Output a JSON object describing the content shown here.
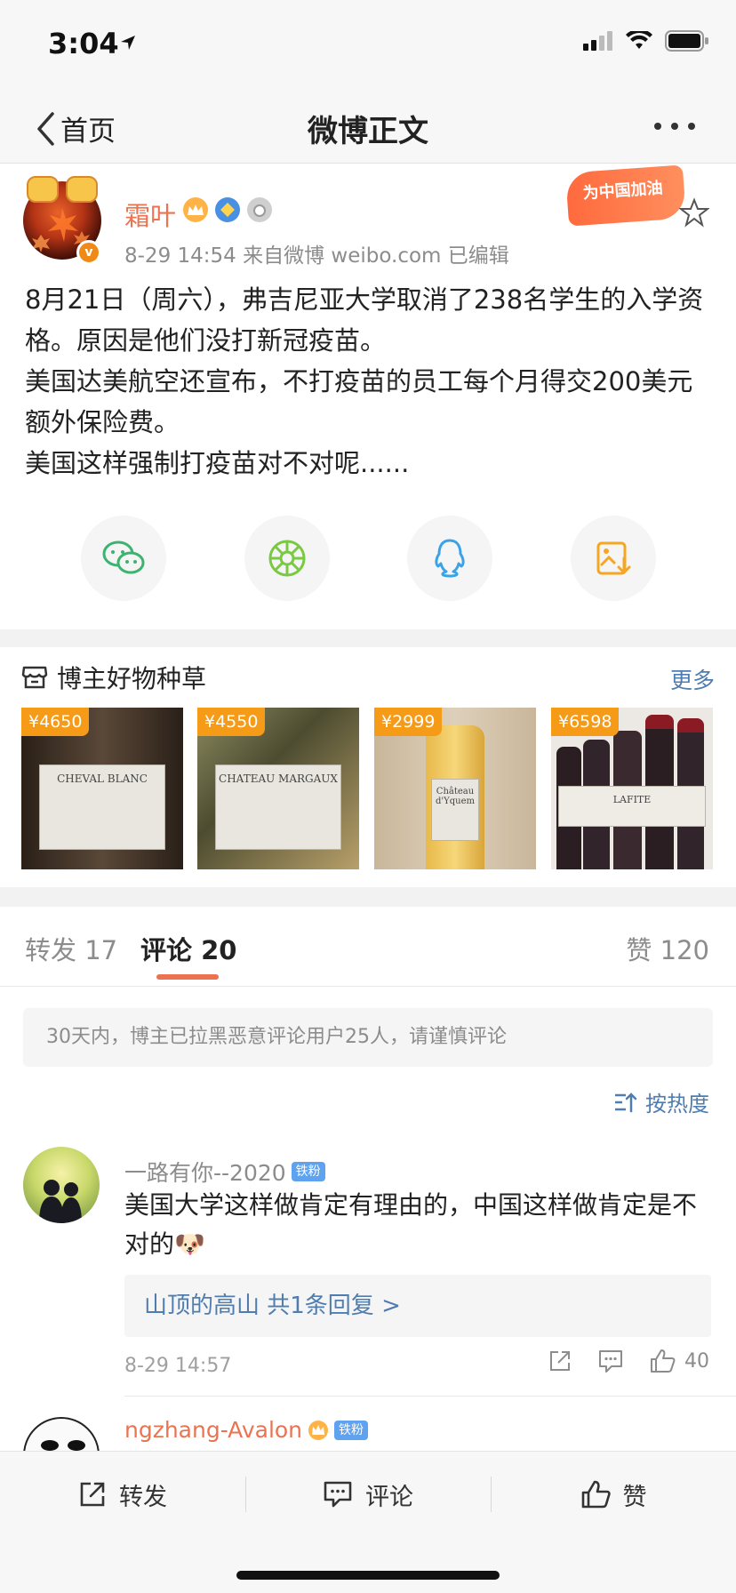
{
  "status_bar": {
    "time": "3:04"
  },
  "nav": {
    "back_label": "首页",
    "title": "微博正文"
  },
  "post": {
    "username": "霜叶",
    "meta": "8-29 14:54  来自微博 weibo.com  已编辑",
    "promo_text": "为中国加油",
    "avatar_badge": "v",
    "content": "8月21日（周六），弗吉尼亚大学取消了238名学生的入学资格。原因是他们没打新冠疫苗。\n美国达美航空还宣布，不打疫苗的员工每个月得交200美元额外保险费。\n美国这样强制打疫苗对不对呢......"
  },
  "share_buttons": [
    {
      "name": "wechat-icon",
      "color": "#3cb371"
    },
    {
      "name": "moments-icon",
      "color": "#7ac943"
    },
    {
      "name": "qq-icon",
      "color": "#3aa3e6"
    },
    {
      "name": "save-image-icon",
      "color": "#f5a623"
    }
  ],
  "shop": {
    "title": "博主好物种草",
    "more": "更多",
    "products": [
      {
        "price": "¥4650",
        "label": "CHEVAL BLANC",
        "bg": "#4a3a2c"
      },
      {
        "price": "¥4550",
        "label": "CHATEAU MARGAUX",
        "bg": "#6b6a45"
      },
      {
        "price": "¥2999",
        "label": "Château d'Yquem",
        "bg": "#cbb89a"
      },
      {
        "price": "¥6598",
        "label": "LAFITE",
        "bg": "#ece9e4"
      }
    ]
  },
  "tabs": {
    "repost": "转发 17",
    "comments": "评论 20",
    "likes": "赞 120"
  },
  "notice": "30天内，博主已拉黑恶意评论用户25人，请谨慎评论",
  "sort_label": "按热度",
  "comments": [
    {
      "name": "一路有你--2020",
      "badge": "铁粉",
      "text": "美国大学这样做肯定有理由的，中国这样做肯定是不对的🐶",
      "reply": "山顶的高山  共1条回复 >",
      "time": "8-29 14:57",
      "likes": "40"
    },
    {
      "name": "ngzhang-Avalon",
      "badge": "铁粉"
    }
  ],
  "toolbar": {
    "repost": "转发",
    "comment": "评论",
    "like": "赞"
  },
  "colors": {
    "accent": "#eb7350",
    "link": "#507daf",
    "price": "#f59b18"
  }
}
